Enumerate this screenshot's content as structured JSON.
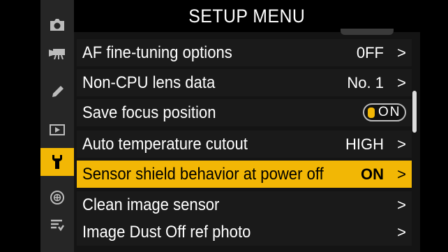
{
  "header": {
    "title": "SETUP MENU"
  },
  "sidebar": {
    "icons": [
      "camera-icon",
      "movie-camera-icon",
      "pencil-icon",
      "playback-icon",
      "wrench-icon",
      "network-icon",
      "my-menu-icon"
    ],
    "active_index": 4
  },
  "menu": {
    "items": [
      {
        "label": "AF fine-tuning options",
        "value": "0FF",
        "chevron": ">"
      },
      {
        "label": "Non-CPU lens data",
        "value": "No. 1",
        "chevron": ">"
      },
      {
        "label": "Save focus position",
        "toggle_text": "ON"
      },
      {
        "label": "Auto temperature cutout",
        "value": "HIGH",
        "chevron": ">"
      },
      {
        "label": "Sensor shield behavior at power off",
        "value": "ON",
        "chevron": ">",
        "selected": true
      },
      {
        "label": "Clean image sensor",
        "value": "",
        "chevron": ">"
      },
      {
        "label": "Image Dust Off ref photo",
        "value": "",
        "chevron": ">"
      }
    ]
  },
  "colors": {
    "accent": "#f2b705",
    "background": "#141414",
    "row": "#1a1a1a",
    "sidebar": "#262626"
  }
}
